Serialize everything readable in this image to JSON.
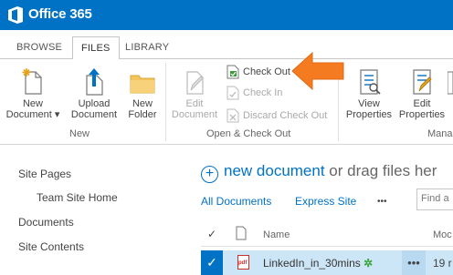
{
  "suite": {
    "brand": "Office 365"
  },
  "tabs": [
    {
      "label": "BROWSE"
    },
    {
      "label": "FILES"
    },
    {
      "label": "LIBRARY"
    }
  ],
  "ribbon": {
    "new_document": {
      "line1": "New",
      "line2": "Document ▾"
    },
    "upload_document": {
      "line1": "Upload",
      "line2": "Document"
    },
    "new_folder": {
      "line1": "New",
      "line2": "Folder"
    },
    "group_new": "New",
    "edit_document": {
      "line1": "Edit",
      "line2": "Document"
    },
    "check_out": "Check Out",
    "check_in": "Check In",
    "discard_check_out": "Discard Check Out",
    "group_open_checkout": "Open & Check Out",
    "view_properties": {
      "line1": "View",
      "line2": "Properties"
    },
    "edit_properties": {
      "line1": "Edit",
      "line2": "Properties"
    },
    "group_manage_partial": "Mana"
  },
  "leftnav": {
    "items": [
      "Site Pages",
      "Team Site Home",
      "Documents",
      "Site Contents"
    ]
  },
  "main": {
    "new_document_link": "new document",
    "drag_text": " or drag files her",
    "views": [
      "All Documents",
      "Express Site",
      "•••"
    ],
    "find_placeholder": "Find a",
    "columns": {
      "check": "✓",
      "name": "Name",
      "modified": "Moc"
    },
    "rows": [
      {
        "name": "LinkedIn_in_30mins",
        "new_marker": "✲",
        "more": "•••",
        "modified": "19 r"
      }
    ]
  },
  "colors": {
    "suite": "#0072c6",
    "accent": "#0072c6",
    "arrow": "#f47b20",
    "selected_row": "#cde6f7"
  }
}
